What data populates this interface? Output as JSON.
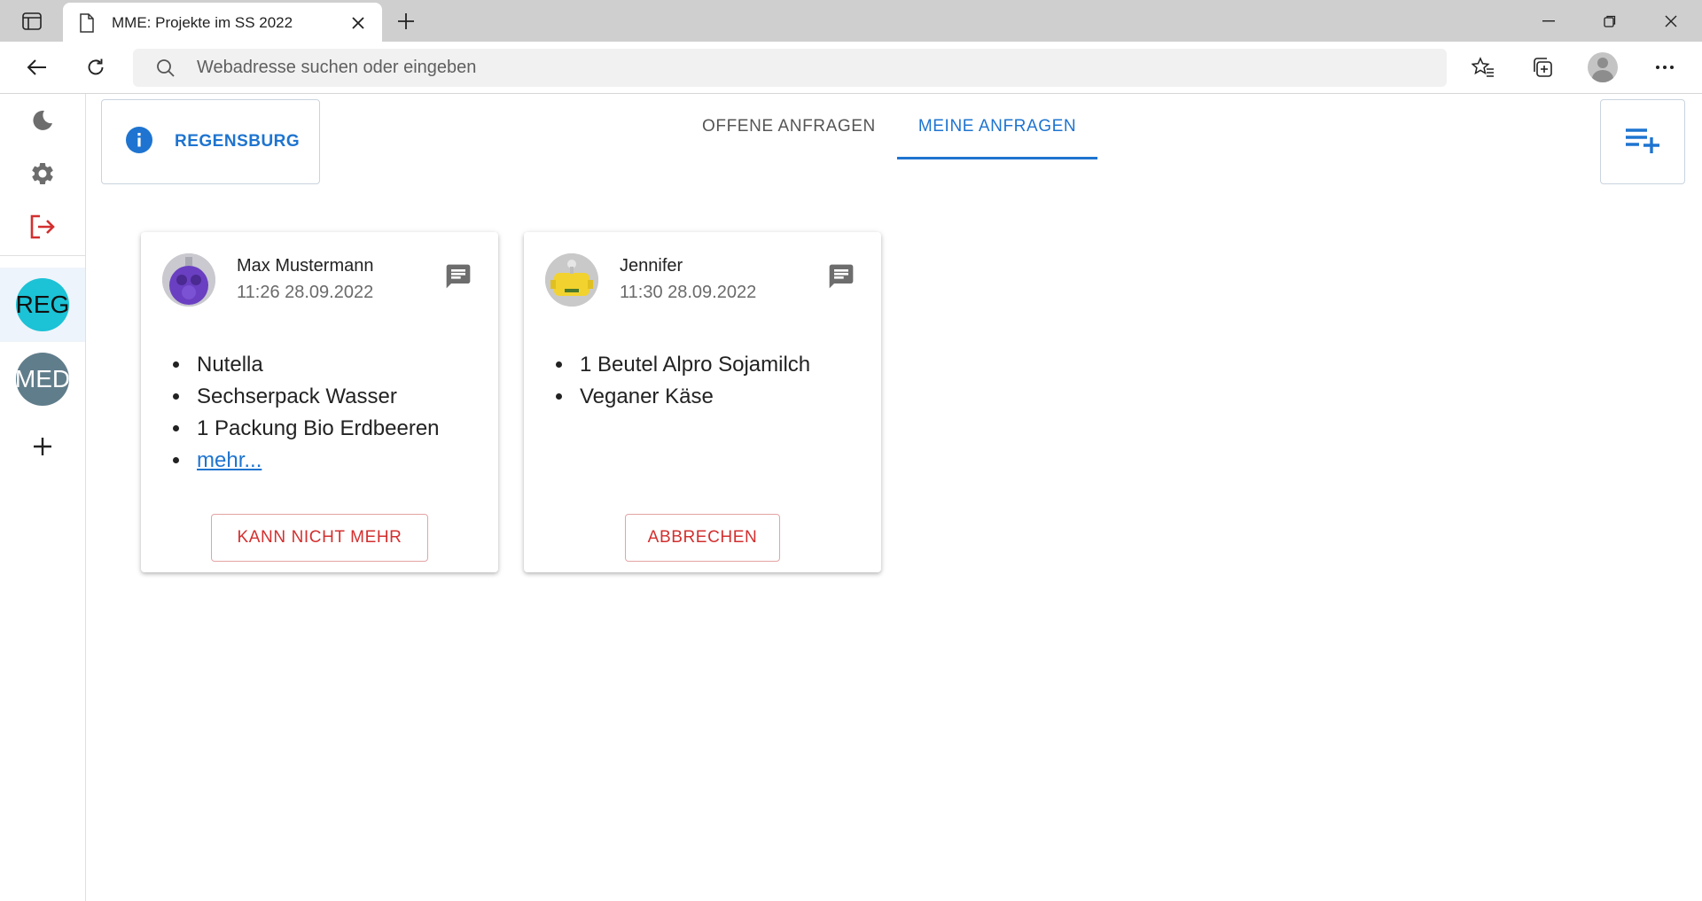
{
  "browser": {
    "tab_title": "MME: Projekte im SS 2022",
    "address_placeholder": "Webadresse suchen oder eingeben"
  },
  "rail": {
    "groups": [
      {
        "label": "REG",
        "color": "#1cc2d6",
        "active": true
      },
      {
        "label": "MED",
        "color": "#607d8b",
        "active": false
      }
    ]
  },
  "header": {
    "location": "REGENSBURG",
    "tabs": [
      {
        "label": "OFFENE ANFRAGEN",
        "active": false
      },
      {
        "label": "MEINE ANFRAGEN",
        "active": true
      }
    ]
  },
  "cards": [
    {
      "name": "Max Mustermann",
      "time": "11:26 28.09.2022",
      "avatar_color": "#6a3fc1",
      "items": [
        "Nutella",
        "Sechserpack Wasser",
        "1 Packung Bio Erdbeeren"
      ],
      "more_link": "mehr...",
      "action": "KANN NICHT MEHR"
    },
    {
      "name": "Jennifer",
      "time": "11:30 28.09.2022",
      "avatar_color": "#f2d22e",
      "items": [
        "1 Beutel Alpro Sojamilch",
        "Veganer Käse"
      ],
      "action": "ABBRECHEN"
    }
  ],
  "colors": {
    "accent": "#1e74d0",
    "danger": "#d32f2f",
    "logout": "#d32f2f"
  }
}
